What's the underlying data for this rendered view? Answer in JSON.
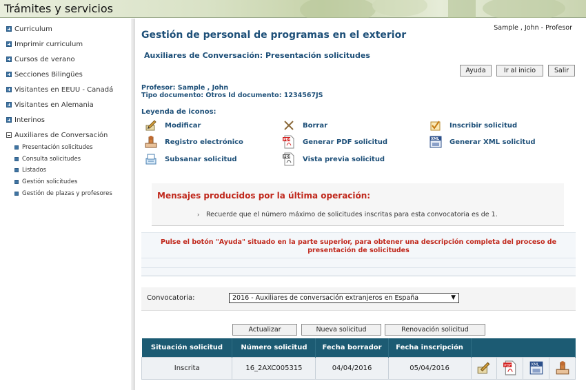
{
  "header": {
    "title": "Trámites y servicios"
  },
  "sidebar": {
    "items": [
      {
        "label": "Curriculum"
      },
      {
        "label": "Imprimir curriculum"
      },
      {
        "label": "Cursos de verano"
      },
      {
        "label": "Secciones Bilingües"
      },
      {
        "label": "Visitantes en EEUU - Canadá"
      },
      {
        "label": "Visitantes en Alemania"
      },
      {
        "label": "Interinos"
      },
      {
        "label": "Auxiliares de Conversación"
      }
    ],
    "subitems": [
      {
        "label": "Presentación solicitudes"
      },
      {
        "label": "Consulta solicitudes"
      },
      {
        "label": "Listados"
      },
      {
        "label": "Gestión solicitudes"
      },
      {
        "label": "Gestión de plazas y profesores"
      }
    ]
  },
  "user": {
    "info": "Sample , John - Profesor"
  },
  "page": {
    "title": "Gestión de personal de programas en el exterior",
    "subtitle": "Auxiliares de Conversación: Presentación solicitudes"
  },
  "toolbar": {
    "help": "Ayuda",
    "home": "Ir al inicio",
    "exit": "Salir"
  },
  "profile": {
    "name_line": "Profesor: Sample , John",
    "doc_line": "Tipo documento: Otros Id documento: 1234567JS"
  },
  "legend": {
    "title": "Leyenda de iconos:",
    "items": [
      {
        "label": "Modificar",
        "icon": "edit-icon"
      },
      {
        "label": "Borrar",
        "icon": "delete-icon"
      },
      {
        "label": "Inscribir solicitud",
        "icon": "check-icon"
      },
      {
        "label": "Registro electrónico",
        "icon": "stamp-icon"
      },
      {
        "label": "Generar PDF solicitud",
        "icon": "pdf-icon"
      },
      {
        "label": "Generar XML solicitud",
        "icon": "xml-icon"
      },
      {
        "label": "Subsanar solicitud",
        "icon": "fix-icon"
      },
      {
        "label": "Vista previa solicitud",
        "icon": "preview-pdf-icon"
      }
    ]
  },
  "messages": {
    "title": "Mensajes producidos por la última operación:",
    "text": "Recuerde que el número máximo de solicitudes inscritas para esta convocatoria es de 1."
  },
  "help": {
    "line1": "Pulse el botón \"Ayuda\" situado en la parte superior, para obtener una descripción completa del proceso de",
    "line2": "presentación de solicitudes"
  },
  "convocatoria": {
    "label": "Convocatoria:",
    "selected": "2016 - Auxiliares de conversación extranjeros en España"
  },
  "actions": {
    "update": "Actualizar",
    "new": "Nueva solicitud",
    "renew": "Renovación solicitud"
  },
  "table": {
    "headers": [
      "Situación solicitud",
      "Número solicitud",
      "Fecha borrador",
      "Fecha inscripción"
    ],
    "rows": [
      {
        "status": "Inscrita",
        "number": "16_2AXC005315",
        "draft": "04/04/2016",
        "inscription": "05/04/2016"
      }
    ]
  },
  "colors": {
    "accent": "#1d4f78",
    "alert": "#c0281c",
    "table_header": "#1c5b73"
  }
}
